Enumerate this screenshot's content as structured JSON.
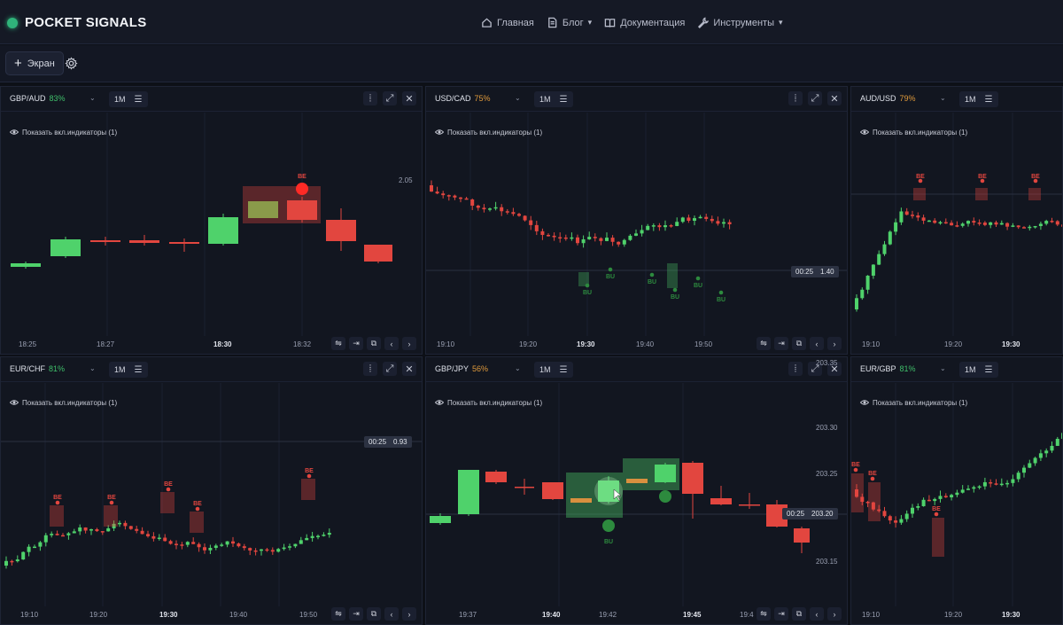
{
  "app": {
    "title": "POCKET SIGNALS"
  },
  "nav": [
    {
      "label": "Главная",
      "icon": "home-icon"
    },
    {
      "label": "Блог",
      "icon": "document-icon",
      "has_dropdown": true
    },
    {
      "label": "Документация",
      "icon": "book-icon"
    },
    {
      "label": "Инструменты",
      "icon": "wrench-icon",
      "has_dropdown": true
    }
  ],
  "toolbar": {
    "add_screen_label": "Экран"
  },
  "indicator_label": "Показать вкл.индикаторы (1)",
  "colors": {
    "bull": "#4fd26b",
    "bear": "#e2463f",
    "accent_green": "#2fb37a",
    "bg": "#0d1017",
    "panel": "#121620"
  },
  "panels": [
    {
      "pair": "GBP/AUD",
      "pct": "83%",
      "pct_color": "green",
      "tf": "1M",
      "price_label": "2.05",
      "x_labels": [
        "18:25",
        "18:27",
        "18:30",
        "18:32"
      ],
      "x_bold": "18:30",
      "signals": [
        "BE"
      ]
    },
    {
      "pair": "USD/CAD",
      "pct": "75%",
      "pct_color": "orange",
      "tf": "1M",
      "timer": "00:25",
      "timer_value": "1.40",
      "x_labels": [
        "19:10",
        "19:20",
        "19:30",
        "19:40",
        "19:50"
      ],
      "x_bold": "19:30",
      "signals": [
        "BU",
        "BU",
        "BU",
        "BU",
        "BU",
        "BU"
      ]
    },
    {
      "pair": "AUD/USD",
      "pct": "79%",
      "pct_color": "orange",
      "tf": "1M",
      "x_labels": [
        "19:10",
        "19:20",
        "19:30"
      ],
      "x_bold": "19:30",
      "signals": [
        "BE",
        "BE",
        "BE"
      ]
    },
    {
      "pair": "EUR/CHF",
      "pct": "81%",
      "pct_color": "green",
      "tf": "1M",
      "timer": "00:25",
      "timer_value": "0.93",
      "x_labels": [
        "19:10",
        "19:20",
        "19:30",
        "19:40",
        "19:50"
      ],
      "x_bold": "19:30",
      "signals": [
        "BE",
        "BE",
        "BE",
        "BE",
        "BE"
      ]
    },
    {
      "pair": "GBP/JPY",
      "pct": "56%",
      "pct_color": "orange",
      "tf": "1M",
      "timer": "00:25",
      "timer_value": "203.20",
      "y_labels": [
        "203.35",
        "203.30",
        "203.25",
        "203.15"
      ],
      "x_labels": [
        "19:37",
        "19:40",
        "19:42",
        "19:45",
        "19:4"
      ],
      "x_bold_list": [
        "19:40",
        "19:45"
      ],
      "signals": [
        "BU"
      ]
    },
    {
      "pair": "EUR/GBP",
      "pct": "81%",
      "pct_color": "green",
      "tf": "1M",
      "x_labels": [
        "19:10",
        "19:20",
        "19:30"
      ],
      "x_bold": "19:30",
      "signals": [
        "BE",
        "BE",
        "BE"
      ]
    }
  ]
}
